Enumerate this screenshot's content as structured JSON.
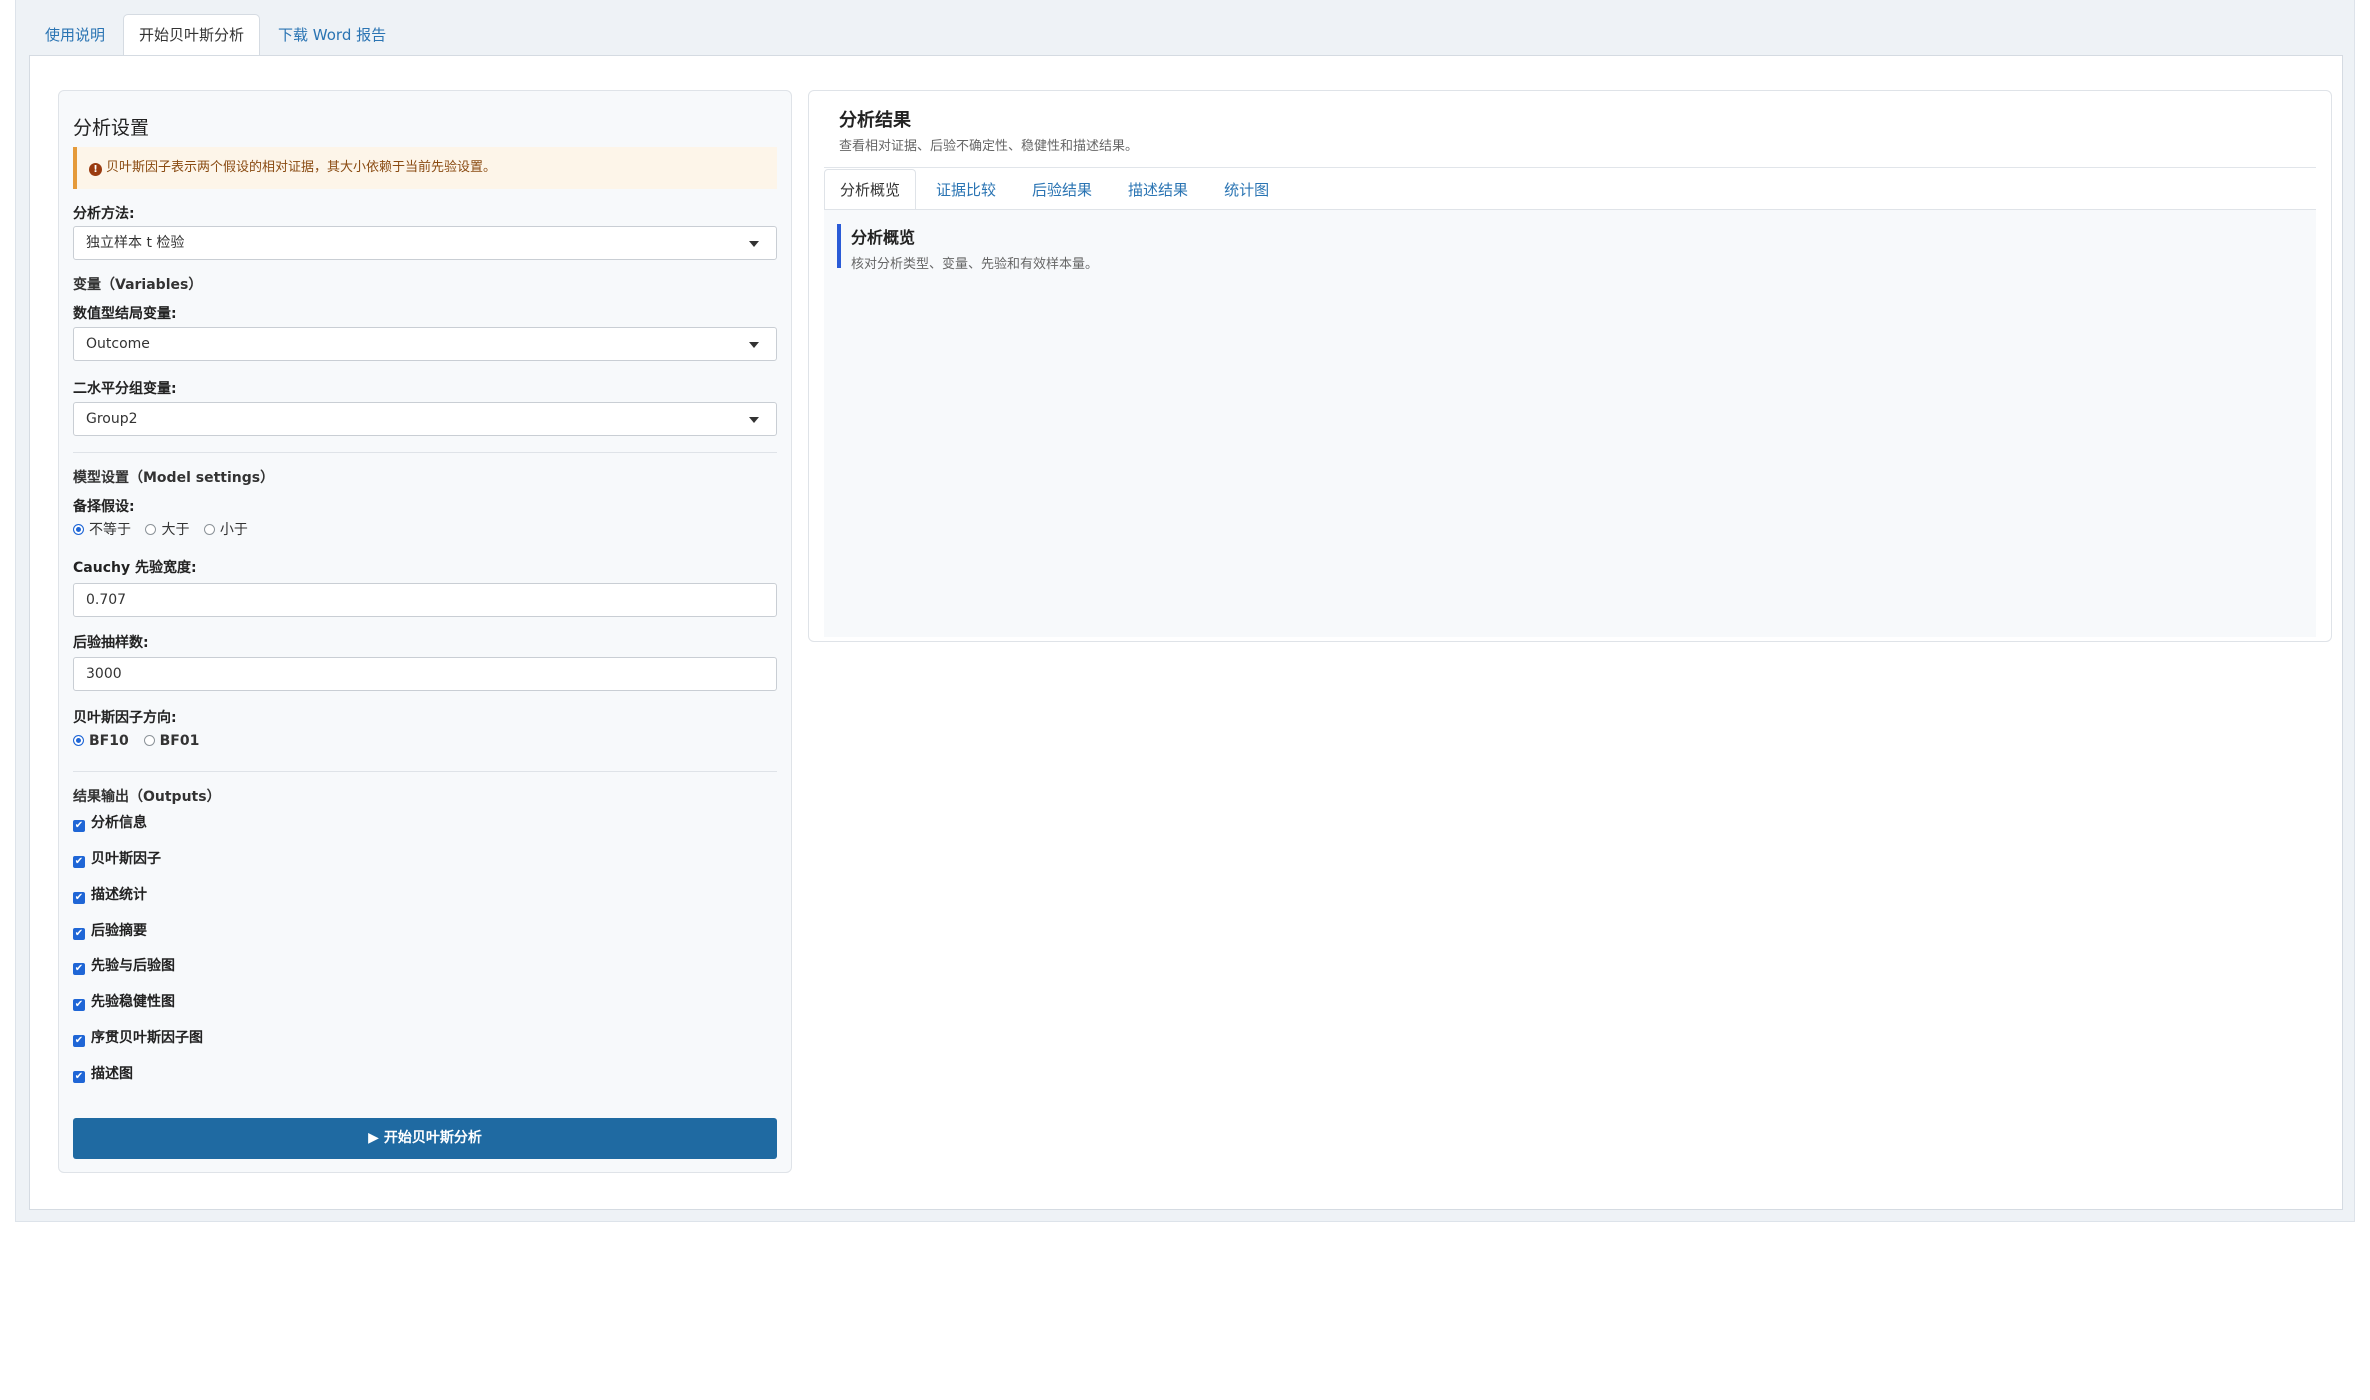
{
  "top_tabs": [
    {
      "label": "使用说明"
    },
    {
      "label": "开始贝叶斯分析"
    },
    {
      "label": "下载 Word 报告"
    }
  ],
  "settings": {
    "title": "分析设置",
    "alert": "贝叶斯因子表示两个假设的相对证据，其大小依赖于当前先验设置。",
    "method_label": "分析方法:",
    "method_value": "独立样本 t 检验",
    "variables_heading": "变量（Variables）",
    "outcome_label": "数值型结局变量:",
    "outcome_value": "Outcome",
    "group_label": "二水平分组变量:",
    "group_value": "Group2",
    "model_heading": "模型设置（Model settings）",
    "alt_label": "备择假设:",
    "alt_options": [
      "不等于",
      "大于",
      "小于"
    ],
    "alt_selected": 0,
    "cauchy_label": "Cauchy 先验宽度:",
    "cauchy_value": "0.707",
    "samples_label": "后验抽样数:",
    "samples_value": "3000",
    "bf_label": "贝叶斯因子方向:",
    "bf_options": [
      "BF10",
      "BF01"
    ],
    "bf_selected": 0,
    "outputs_heading": "结果输出（Outputs）",
    "outputs": [
      "分析信息",
      "贝叶斯因子",
      "描述统计",
      "后验摘要",
      "先验与后验图",
      "先验稳健性图",
      "序贯贝叶斯因子图",
      "描述图"
    ],
    "run_button": "开始贝叶斯分析"
  },
  "results": {
    "title": "分析结果",
    "subtitle": "查看相对证据、后验不确定性、稳健性和描述结果。",
    "tabs": [
      "分析概览",
      "证据比较",
      "后验结果",
      "描述结果",
      "统计图"
    ],
    "active_tab": 0,
    "overview_title": "分析概览",
    "overview_sub": "核对分析类型、变量、先验和有效样本量。"
  }
}
